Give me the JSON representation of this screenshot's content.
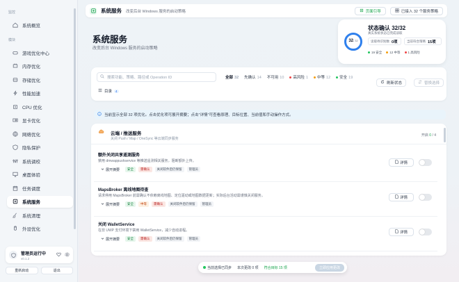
{
  "sidebar": {
    "group_monitor": "监控",
    "overview": "系统概览",
    "group_modules": "模块",
    "items": [
      {
        "label": "游戏优化中心",
        "icon": "gamepad-icon"
      },
      {
        "label": "内存优化",
        "icon": "memory-icon"
      },
      {
        "label": "存储优化",
        "icon": "storage-icon"
      },
      {
        "label": "性能加速",
        "icon": "lightning-icon"
      },
      {
        "label": "CPU 优化",
        "icon": "cpu-icon"
      },
      {
        "label": "显卡优化",
        "icon": "gpu-icon"
      },
      {
        "label": "网络优化",
        "icon": "network-icon"
      },
      {
        "label": "隐私保护",
        "icon": "shield-icon"
      },
      {
        "label": "系统调校",
        "icon": "tune-icon"
      },
      {
        "label": "桌面体验",
        "icon": "desktop-icon"
      },
      {
        "label": "任务调度",
        "icon": "calendar-icon"
      },
      {
        "label": "系统服务",
        "icon": "services-icon",
        "active": true
      },
      {
        "label": "系统清理",
        "icon": "broom-icon"
      },
      {
        "label": "外设优化",
        "icon": "peripheral-icon"
      }
    ],
    "admin": {
      "name": "管理员运行中",
      "version": "v0.1.2"
    },
    "restart_label": "重新启动",
    "exit_label": "退出"
  },
  "topbar": {
    "title": "系统服务",
    "subtitle": "改变后台 Windows 服务的启动策略",
    "guide_label": "页面引导",
    "imported_label": "已接入 32 个服务策略"
  },
  "hero": {
    "title": "系统服务",
    "subtitle": "改变后台 Windows 服务的启动策略"
  },
  "status": {
    "title": "状态确认  32/32",
    "subtitle": "真实系统状态已完成读取",
    "ring_value": "32",
    "ring_total": "/ 32",
    "ring_fraction": 1.0,
    "box1_label": "读取待识别数",
    "box1_value": "0项",
    "box2_label": "当前符合策略",
    "box2_value": "15项",
    "legend": [
      {
        "label": "19 安全",
        "color": "#22c55e"
      },
      {
        "label": "12 中等",
        "color": "#f59e0b"
      },
      {
        "label": "1 高风险",
        "color": "#ef4444"
      }
    ]
  },
  "filter": {
    "search_placeholder": "搜索功能、策略、路径或 Operation ID",
    "tabs": [
      {
        "label": "全部",
        "count": "32",
        "active": true
      },
      {
        "label": "先确认",
        "count": "14"
      },
      {
        "label": "不可用",
        "count": "10"
      },
      {
        "label": "高风险",
        "count": "1",
        "dot": "#ef4444"
      },
      {
        "label": "中等",
        "count": "12",
        "dot": "#f59e0b"
      },
      {
        "label": "安全",
        "count": "19",
        "dot": "#22c55e"
      }
    ],
    "refresh_label": "刷新状态",
    "select_label": "替换选择",
    "toc_label": "目录",
    "toc_count": "4"
  },
  "notice": "当前显示全部 32 项优化。点击优化项可展开摘要；点击\"详情\"可查看原理、目标位置、当前值和手动操作方式。",
  "category": {
    "title": "云端 / 推送服务",
    "subtitle": "关闭 Push / Map / OneSync 等云端同步服务",
    "count_prefix": "开启",
    "count_on": "0",
    "count_total": "/ 4"
  },
  "items": [
    {
      "title": "额外关闭共享遥测服务",
      "desc": "禁用 dmwappushservice 等推送遥测相关服务，阻断额外上传。",
      "tags": [
        {
          "label": "安全",
          "kind": "safe"
        },
        {
          "label": "需确认",
          "kind": "warn"
        },
        {
          "label": "关闭软件后仍保留",
          "kind": "plain"
        },
        {
          "label": "管理员",
          "kind": "plain"
        }
      ]
    },
    {
      "title": "MapsBroker 离线地图待查",
      "desc": "请求停用 MapsBroker 前需确认不依赖离线地图、定位驱动或地图数据更新；实际后台活动需谨慎关闭服务。",
      "tags": [
        {
          "label": "安全",
          "kind": "safe"
        },
        {
          "label": "中等",
          "kind": "mid"
        },
        {
          "label": "需确认",
          "kind": "warn"
        },
        {
          "label": "关闭软件后仍保留",
          "kind": "plain"
        },
        {
          "label": "管理员",
          "kind": "plain"
        }
      ]
    },
    {
      "title": "关闭 WalletService",
      "desc": "在非 UWP 支付环境下禁用 WalletService，减少自动进程。",
      "tags": [
        {
          "label": "安全",
          "kind": "safe"
        },
        {
          "label": "需确认",
          "kind": "warn"
        },
        {
          "label": "关闭软件后仍保留",
          "kind": "plain"
        },
        {
          "label": "管理员",
          "kind": "plain"
        }
      ]
    }
  ],
  "item_common": {
    "expand_label": "展开摘要",
    "detail_label": "详情"
  },
  "bottom": {
    "synced_label": "当前选择已同步",
    "changes_label": "本次更改 0 项",
    "strategy_label": "符合目标 15 项",
    "apply_label": "立即应用更改"
  }
}
